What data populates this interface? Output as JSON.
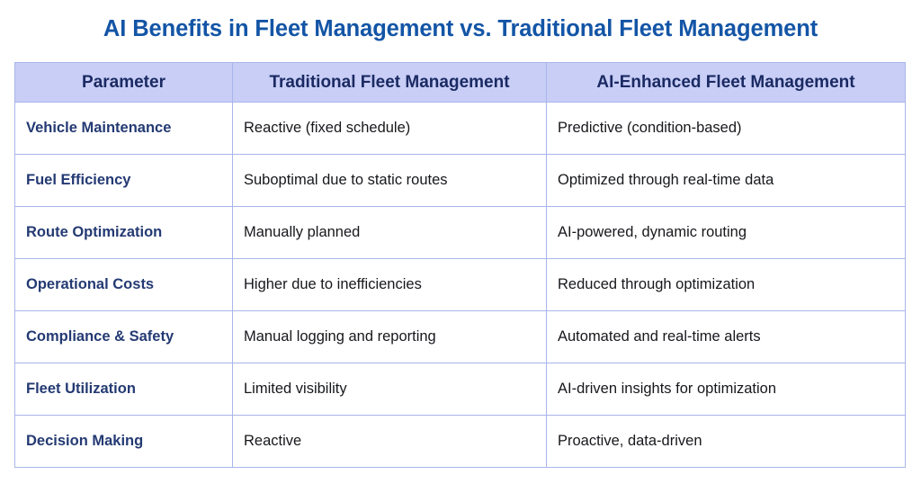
{
  "title": "AI Benefits in Fleet Management vs. Traditional Fleet Management",
  "colors": {
    "title_blue": "#1355a6",
    "header_bg": "#c8cef6",
    "header_text": "#1b2a63",
    "border": "#a9b5ea",
    "param_text": "#243a73",
    "body_text": "#17181c",
    "page_bg": "#ffffff"
  },
  "table": {
    "headers": [
      "Parameter",
      "Traditional Fleet Management",
      "AI-Enhanced Fleet Management"
    ],
    "rows": [
      {
        "parameter": "Vehicle Maintenance",
        "traditional": "Reactive (fixed schedule)",
        "ai_enhanced": "Predictive (condition-based)"
      },
      {
        "parameter": "Fuel Efficiency",
        "traditional": "Suboptimal due to static routes",
        "ai_enhanced": "Optimized through real-time data"
      },
      {
        "parameter": "Route Optimization",
        "traditional": "Manually planned",
        "ai_enhanced": "AI-powered, dynamic routing"
      },
      {
        "parameter": "Operational Costs",
        "traditional": "Higher due to inefficiencies",
        "ai_enhanced": "Reduced through optimization"
      },
      {
        "parameter": "Compliance & Safety",
        "traditional": "Manual logging and reporting",
        "ai_enhanced": "Automated and real-time alerts"
      },
      {
        "parameter": "Fleet Utilization",
        "traditional": "Limited visibility",
        "ai_enhanced": "AI-driven insights for optimization"
      },
      {
        "parameter": "Decision Making",
        "traditional": "Reactive",
        "ai_enhanced": "Proactive, data-driven"
      }
    ]
  }
}
